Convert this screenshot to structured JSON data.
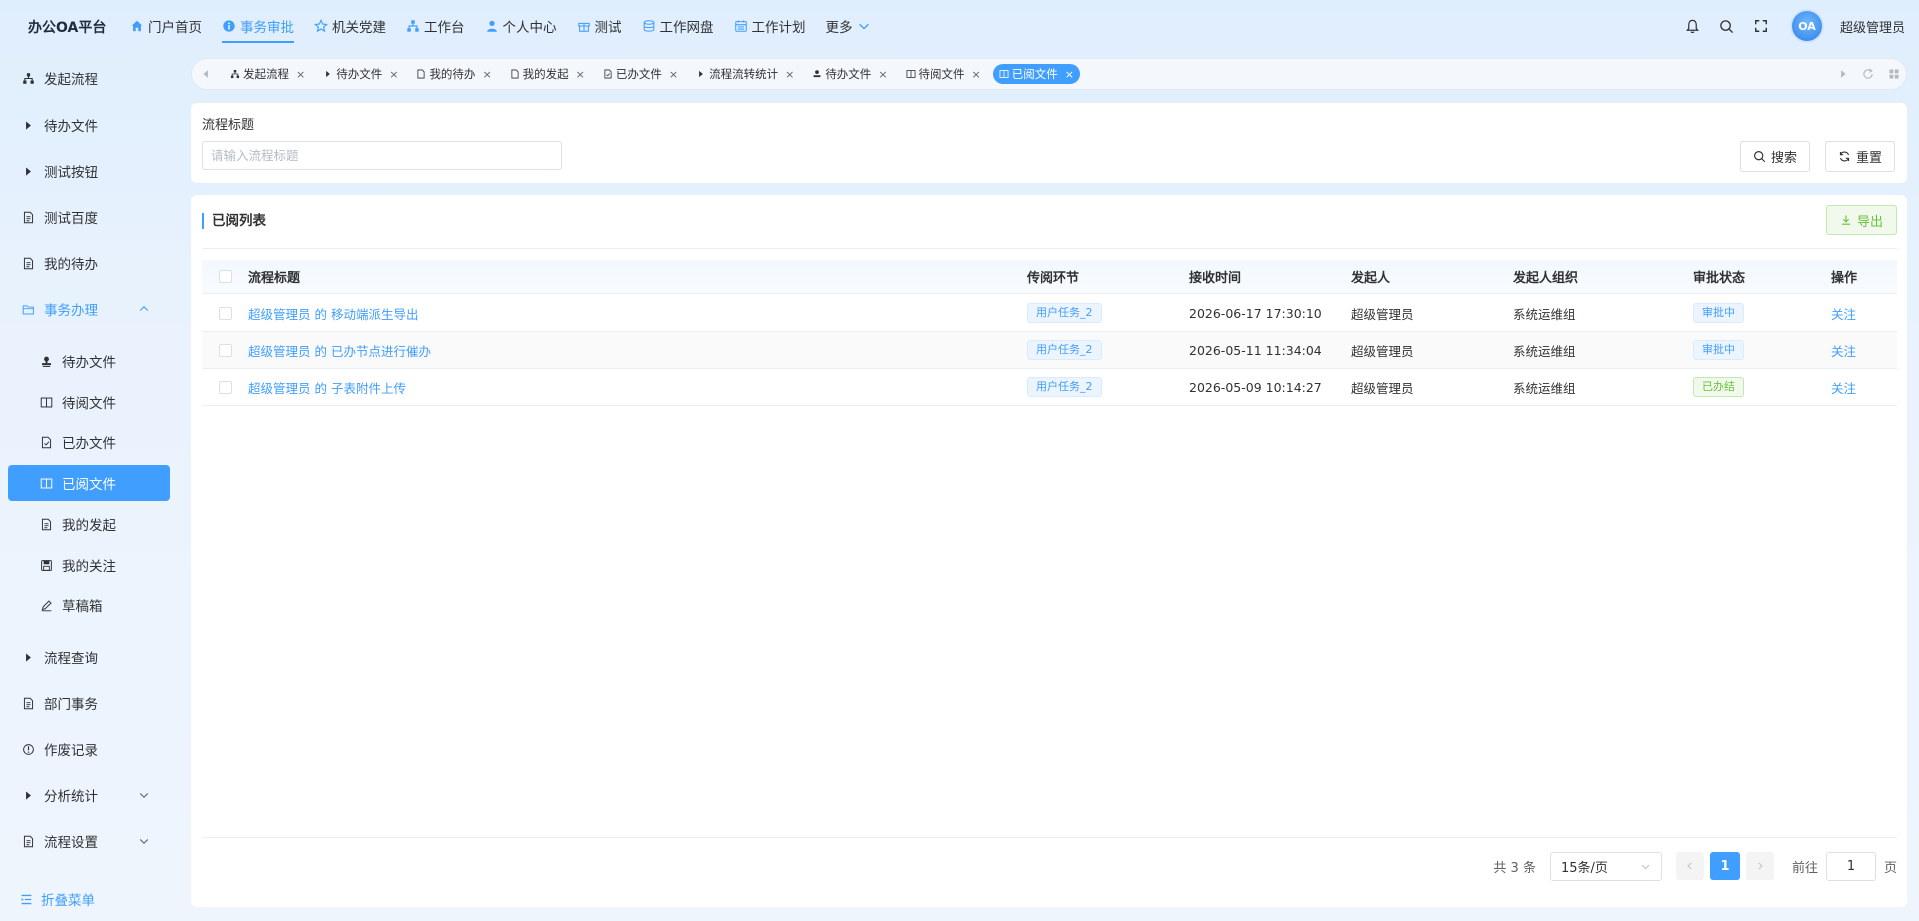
{
  "app": {
    "brand": "办公OA平台"
  },
  "nav": [
    {
      "label": "门户首页",
      "icon": "home-icon"
    },
    {
      "label": "事务审批",
      "icon": "info-circle-icon",
      "active": true
    },
    {
      "label": "机关党建",
      "icon": "star-icon"
    },
    {
      "label": "工作台",
      "icon": "org-tree-icon"
    },
    {
      "label": "个人中心",
      "icon": "user-icon"
    },
    {
      "label": "测试",
      "icon": "gift-icon"
    },
    {
      "label": "工作网盘",
      "icon": "database-icon"
    },
    {
      "label": "工作计划",
      "icon": "calendar-icon"
    },
    {
      "label": "更多",
      "icon": "chevron-down-icon"
    }
  ],
  "header": {
    "user_name": "超级管理员",
    "avatar_text": "OA"
  },
  "sidebar": {
    "items": [
      {
        "label": "发起流程",
        "icon": "org-tree-icon"
      },
      {
        "label": "待办文件",
        "icon": "caret-right-icon"
      },
      {
        "label": "测试按钮",
        "icon": "caret-right-icon"
      },
      {
        "label": "测试百度",
        "icon": "document-icon"
      },
      {
        "label": "我的待办",
        "icon": "document-icon"
      },
      {
        "label": "事务办理",
        "icon": "folder-open-icon"
      },
      {
        "label": "待办文件",
        "icon": "stamp-icon"
      },
      {
        "label": "待阅文件",
        "icon": "book-icon"
      },
      {
        "label": "已办文件",
        "icon": "doc-check-icon"
      },
      {
        "label": "已阅文件",
        "icon": "book-icon"
      },
      {
        "label": "我的发起",
        "icon": "document-icon"
      },
      {
        "label": "我的关注",
        "icon": "save-icon"
      },
      {
        "label": "草稿箱",
        "icon": "edit-icon"
      },
      {
        "label": "流程查询",
        "icon": "caret-right-icon"
      },
      {
        "label": "部门事务",
        "icon": "document-icon"
      },
      {
        "label": "作废记录",
        "icon": "info-circle-icon"
      },
      {
        "label": "分析统计",
        "icon": "caret-right-icon"
      },
      {
        "label": "流程设置",
        "icon": "document-icon"
      }
    ],
    "collapse_label": "折叠菜单"
  },
  "tabs": [
    {
      "label": "发起流程"
    },
    {
      "label": "待办文件"
    },
    {
      "label": "我的待办"
    },
    {
      "label": "我的发起"
    },
    {
      "label": "已办文件"
    },
    {
      "label": "流程流转统计"
    },
    {
      "label": "待办文件"
    },
    {
      "label": "待阅文件"
    },
    {
      "label": "已阅文件",
      "active": true
    }
  ],
  "search": {
    "label": "流程标题",
    "placeholder": "请输入流程标题",
    "search_btn": "搜索",
    "reset_btn": "重置"
  },
  "table": {
    "title": "已阅列表",
    "export_btn": "导出",
    "columns": [
      "流程标题",
      "传阅环节",
      "接收时间",
      "发起人",
      "发起人组织",
      "审批状态",
      "操作"
    ],
    "rows": [
      {
        "title": "超级管理员 的 移动端派生导出",
        "step": "用户任务_2",
        "time": "2026-06-17 17:30:10",
        "initiator": "超级管理员",
        "org": "系统运维组",
        "status": "审批中",
        "status_color": "#409eff",
        "op": "关注"
      },
      {
        "title": "超级管理员 的 已办节点进行催办",
        "step": "用户任务_2",
        "time": "2026-05-11 11:34:04",
        "initiator": "超级管理员",
        "org": "系统运维组",
        "status": "审批中",
        "status_color": "#409eff",
        "op": "关注"
      },
      {
        "title": "超级管理员 的 子表附件上传",
        "step": "用户任务_2",
        "time": "2026-05-09 10:14:27",
        "initiator": "超级管理员",
        "org": "系统运维组",
        "status": "已办结",
        "status_color": "#67c23a",
        "op": "关注"
      }
    ]
  },
  "pagination": {
    "total": "共 3 条",
    "page_size": "15条/页",
    "current_page": "1",
    "goto_label": "前往",
    "goto_value": "1",
    "page_unit": "页"
  },
  "colors": {
    "accent": "#409eff",
    "success": "#67c23a"
  }
}
